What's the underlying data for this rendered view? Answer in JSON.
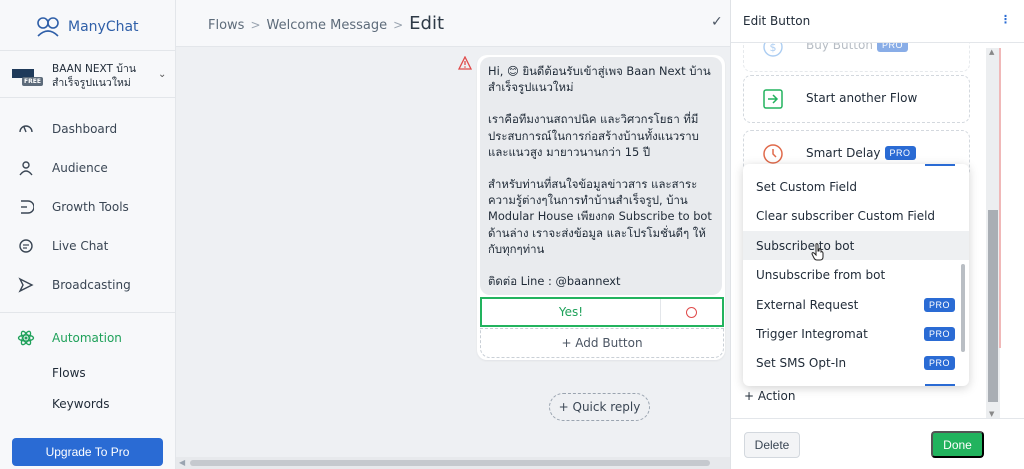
{
  "brand": {
    "name": "ManyChat"
  },
  "account": {
    "name": "BAAN NEXT บ้านสำเร็จรูปแนวใหม่",
    "badge": "FREE"
  },
  "sidebar": {
    "items": [
      {
        "label": "Dashboard",
        "icon": "dashboard-gauge-icon"
      },
      {
        "label": "Audience",
        "icon": "person-icon"
      },
      {
        "label": "Growth Tools",
        "icon": "growth-tools-icon"
      },
      {
        "label": "Live Chat",
        "icon": "chat-bubble-icon"
      },
      {
        "label": "Broadcasting",
        "icon": "send-icon"
      },
      {
        "label": "Automation",
        "icon": "atom-icon",
        "active": true
      }
    ],
    "sub_items": [
      "Flows",
      "Keywords"
    ],
    "upgrade_label": "Upgrade To Pro"
  },
  "header": {
    "breadcrumb": [
      "Flows",
      "Welcome Message"
    ],
    "current": "Edit",
    "separator": ">"
  },
  "message": {
    "paragraphs": [
      "Hi, 😊 ยินดีต้อนรับเข้าสู่เพจ Baan Next บ้านสำเร็จรูปแนวใหม่",
      "เราคือทีมงานสถาปนิค และวิศวกรโยธา ที่มีประสบการณ์ในการก่อสร้างบ้านทั้งแนวราบ และแนวสูง มายาวนานกว่า 15 ปี",
      "สำหรับท่านที่สนใจข้อมูลข่าวสาร และสาระความรู้ต่างๆในการทำบ้านสำเร็จรูป, บ้าน Modular House เพียงกด Subscribe to bot ด้านล่าง เราจะส่งข้อมูล และโปรโมชั่นดีๆ ให้กับทุกๆท่าน",
      "ติดต่อ Line : @baannext"
    ],
    "button_label": "Yes!",
    "add_button_label": "+ Add Button",
    "quick_reply_label": "+ Quick reply"
  },
  "panel": {
    "title": "Edit Button",
    "options": [
      {
        "label": "Buy Button",
        "pro": "PRO",
        "icon": "dollar-icon"
      },
      {
        "label": "Start another Flow",
        "icon": "flow-enter-icon"
      },
      {
        "label": "Smart Delay",
        "pro": "PRO",
        "icon": "clock-icon"
      }
    ],
    "dropdown": [
      {
        "label": "Set Custom Field"
      },
      {
        "label": "Clear subscriber Custom Field"
      },
      {
        "label": "Subscribe to bot",
        "hover": true
      },
      {
        "label": "Unsubscribe from bot"
      },
      {
        "label": "External Request",
        "pro": "PRO"
      },
      {
        "label": "Trigger Integromat",
        "pro": "PRO"
      },
      {
        "label": "Set SMS Opt-In",
        "pro": "PRO"
      }
    ],
    "add_action_label": "+ Action",
    "delete_label": "Delete",
    "done_label": "Done"
  },
  "colors": {
    "accent": "#22b35e",
    "primary": "#2a6bd4",
    "warning": "#e04b4b"
  }
}
